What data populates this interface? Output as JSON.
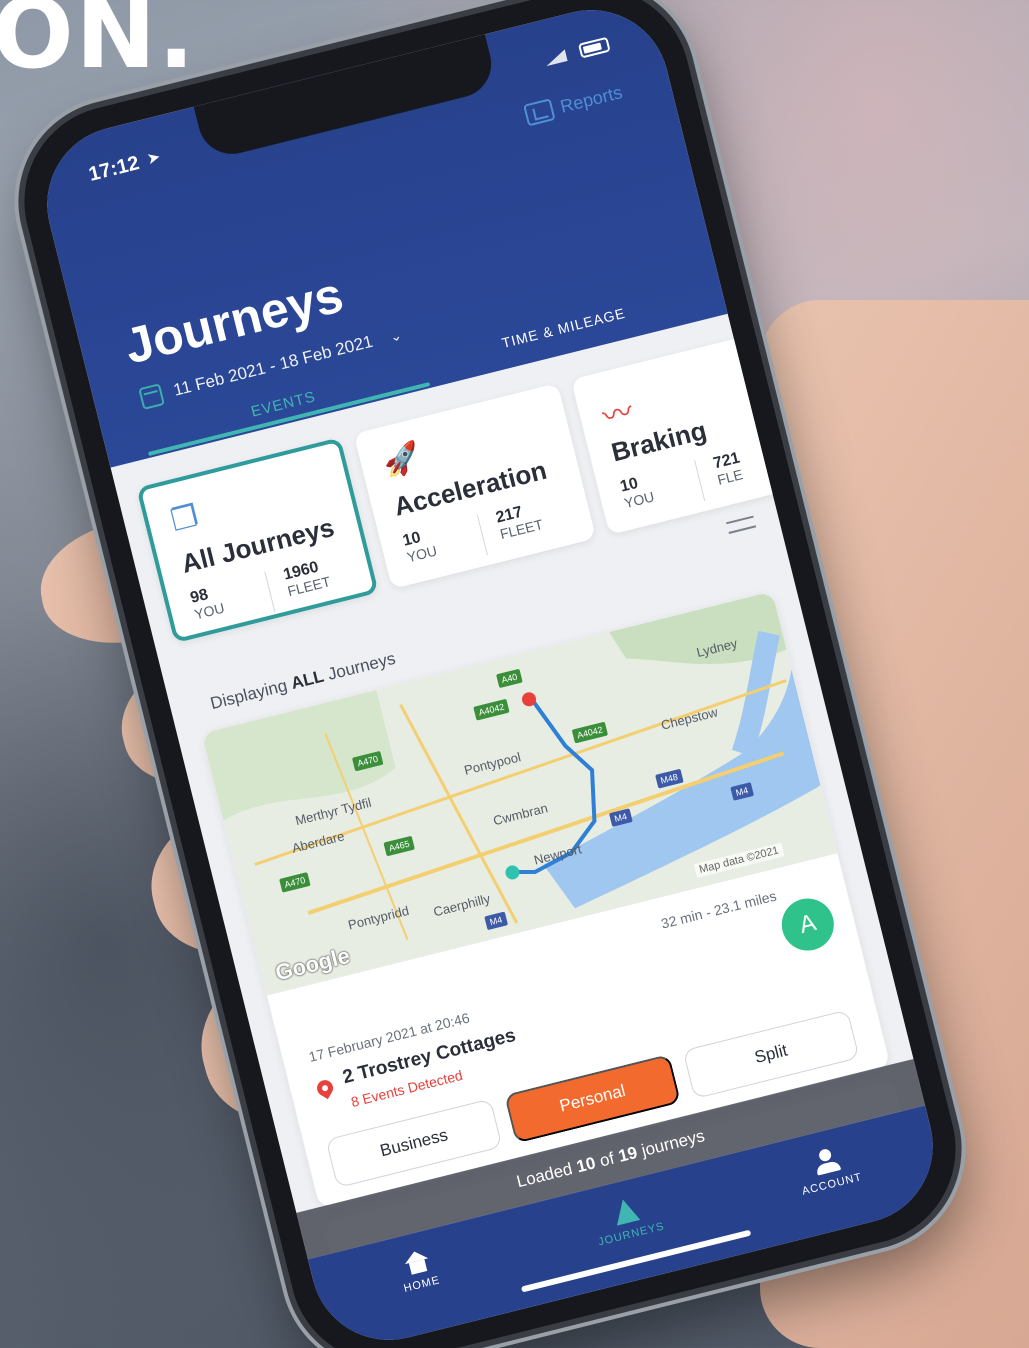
{
  "headline": "ON.",
  "status_bar": {
    "time": "17:12"
  },
  "header": {
    "reports_label": "Reports",
    "title": "Journeys",
    "date_range": "11 Feb 2021 - 18 Feb 2021",
    "tabs": [
      {
        "label": "EVENTS",
        "active": true
      },
      {
        "label": "TIME & MILEAGE",
        "active": false
      }
    ]
  },
  "summary_cards": [
    {
      "title": "All Journeys",
      "you_value": "98",
      "you_label": "YOU",
      "fleet_value": "1960",
      "fleet_label": "FLEET",
      "selected": true
    },
    {
      "title": "Acceleration",
      "you_value": "10",
      "you_label": "YOU",
      "fleet_value": "217",
      "fleet_label": "FLEET",
      "selected": false
    },
    {
      "title": "Braking",
      "you_value": "10",
      "you_label": "YOU",
      "fleet_value": "721",
      "fleet_label": "FLE",
      "selected": false
    }
  ],
  "display_label": {
    "prefix": "Displaying",
    "emphasis": "ALL",
    "suffix": "Journeys"
  },
  "map": {
    "labels": [
      "Merthyr Tydfil",
      "Aberdare",
      "Pontypool",
      "Cwmbran",
      "Newport",
      "Chepstow",
      "Lydney",
      "Pontypridd",
      "Caerphilly"
    ],
    "road_badges": [
      "A470",
      "A465",
      "A4042",
      "A40",
      "A4042",
      "A470"
    ],
    "motorway_badges": [
      "M4",
      "M48",
      "M4",
      "M4"
    ],
    "credit": "Map data ©2021",
    "brand": "Google"
  },
  "journey": {
    "duration": "32 min - 23.1 miles",
    "avatar_initial": "A",
    "date": "17 February 2021 at 20:46",
    "address": "2 Trostrey Cottages",
    "events": "8 Events Detected",
    "buttons": {
      "business": "Business",
      "personal": "Personal",
      "split": "Split"
    }
  },
  "toast": {
    "prefix": "Loaded",
    "loaded": "10",
    "middle": "of",
    "total": "19",
    "suffix": "journeys"
  },
  "tabbar": {
    "home": "HOME",
    "journeys": "JOURNEYS",
    "account": "ACCOUNT"
  },
  "colors": {
    "brand_blue": "#27418c",
    "teal": "#3fb6b1",
    "orange": "#f26a2e",
    "red": "#e8413c",
    "green": "#2fc28b"
  }
}
